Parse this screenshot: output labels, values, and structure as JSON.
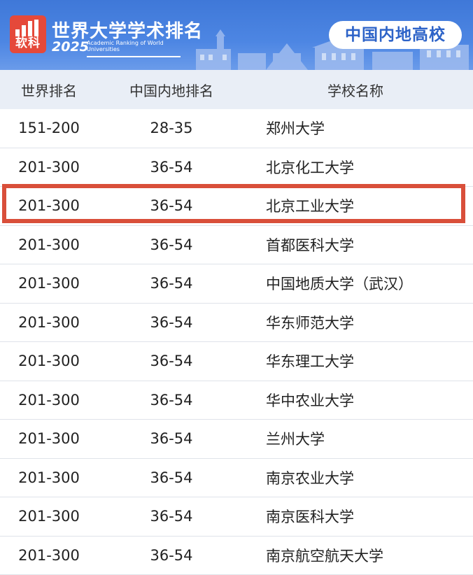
{
  "header": {
    "logo_text": "软科",
    "title": "世界大学学术排名",
    "year": "2025",
    "subtitle": "Academic Ranking of World Universities",
    "badge": "中国内地高校"
  },
  "table": {
    "columns": [
      "世界排名",
      "中国内地排名",
      "学校名称"
    ],
    "rows": [
      {
        "world": "151-200",
        "mainland": "28-35",
        "name": "郑州大学"
      },
      {
        "world": "201-300",
        "mainland": "36-54",
        "name": "北京化工大学"
      },
      {
        "world": "201-300",
        "mainland": "36-54",
        "name": "北京工业大学"
      },
      {
        "world": "201-300",
        "mainland": "36-54",
        "name": "首都医科大学"
      },
      {
        "world": "201-300",
        "mainland": "36-54",
        "name": "中国地质大学（武汉）"
      },
      {
        "world": "201-300",
        "mainland": "36-54",
        "name": "华东师范大学"
      },
      {
        "world": "201-300",
        "mainland": "36-54",
        "name": "华东理工大学"
      },
      {
        "world": "201-300",
        "mainland": "36-54",
        "name": "华中农业大学"
      },
      {
        "world": "201-300",
        "mainland": "36-54",
        "name": "兰州大学"
      },
      {
        "world": "201-300",
        "mainland": "36-54",
        "name": "南京农业大学"
      },
      {
        "world": "201-300",
        "mainland": "36-54",
        "name": "南京医科大学"
      },
      {
        "world": "201-300",
        "mainland": "36-54",
        "name": "南京航空航天大学"
      }
    ],
    "highlighted_row": 2
  },
  "colors": {
    "banner": "#4d86e3",
    "badge_text": "#2d63c8",
    "logo": "#e5493a",
    "header_bg": "#e9eef6",
    "highlight_border": "#d94f3a"
  }
}
